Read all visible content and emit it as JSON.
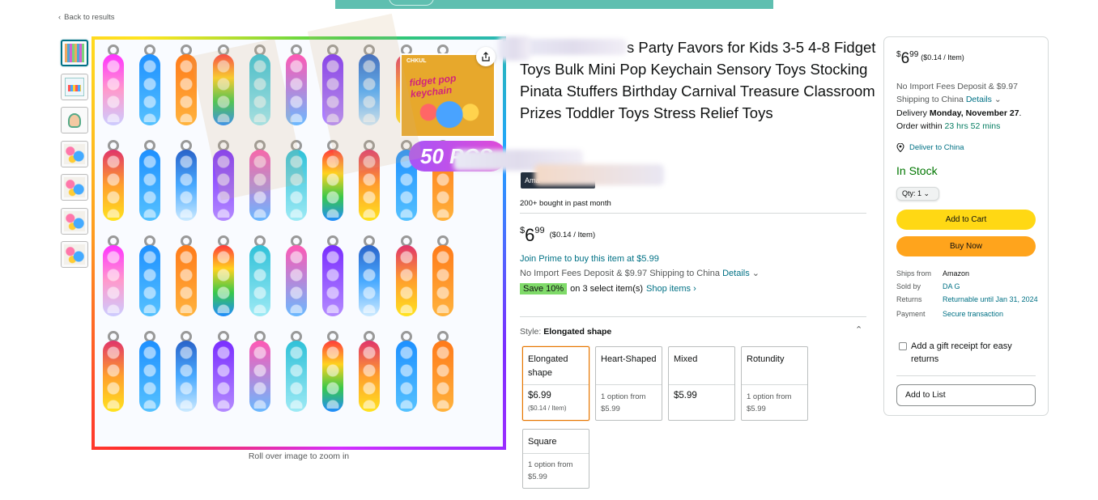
{
  "nav": {
    "back_label": "Back to results"
  },
  "gallery": {
    "zoom_hint": "Roll over image to zoom in",
    "product_badge_brand": "CHKUL",
    "product_badge_text": "fidget pop keychain",
    "pcs_badge": "50 PCS"
  },
  "product": {
    "title_visible": "s Party Favors for Kids 3-5 4-8 Fidget Toys Bulk Mini Pop Keychain Sensory Toys Stocking Pinata Stuffers Birthday Carnival Treasure Classroom Prizes Toddler Toys Stress Relief Toys",
    "store_pill": "Ama",
    "bought": "200+ bought in past month",
    "price_symbol": "$",
    "price_whole": "6",
    "price_fraction": "99",
    "price_unit": "($0.14 / Item)",
    "prime_text": "Join Prime to buy this item at $5.99",
    "import_text": "No Import Fees Deposit & $9.97 Shipping to China",
    "import_link": "Details",
    "save_badge": "Save 10%",
    "save_text": "on 3 select item(s)",
    "shop_items": "Shop items ›",
    "style_label": "Style:",
    "style_value": "Elongated shape",
    "styles": [
      {
        "name": "Elongated shape",
        "price": "$6.99",
        "sub": "($0.14 / Item)"
      },
      {
        "name": "Heart-Shaped",
        "opt": "1 option from",
        "price": "$5.99"
      },
      {
        "name": "Mixed",
        "price": "$5.99"
      },
      {
        "name": "Rotundity",
        "opt": "1 option from",
        "price": "$5.99"
      },
      {
        "name": "Square",
        "opt": "1 option from",
        "price": "$5.99"
      }
    ]
  },
  "buybox": {
    "price_symbol": "$",
    "price_whole": "6",
    "price_fraction": "99",
    "price_unit": "($0.14 / Item)",
    "import_text": "No Import Fees Deposit & $9.97 Shipping to China",
    "import_link": "Details",
    "delivery_prefix": "Delivery",
    "delivery_date": "Monday, November 27",
    "order_within": "Order within",
    "countdown": "23 hrs 52 mins",
    "deliver_to": "Deliver to China",
    "stock": "In Stock",
    "qty": "Qty: 1",
    "add_to_cart": "Add to Cart",
    "buy_now": "Buy Now",
    "ships_from_label": "Ships from",
    "ships_from": "Amazon",
    "sold_by_label": "Sold by",
    "sold_by": "DA G",
    "returns_label": "Returns",
    "returns": "Returnable until Jan 31, 2024",
    "payment_label": "Payment",
    "payment": "Secure transaction",
    "gift_receipt": "Add a gift receipt for easy returns",
    "add_to_list": "Add to List"
  },
  "colors": {
    "link": "#007185",
    "cart": "#ffd814",
    "buy": "#ffa41c",
    "stock": "#007600",
    "selected": "#e77600"
  }
}
